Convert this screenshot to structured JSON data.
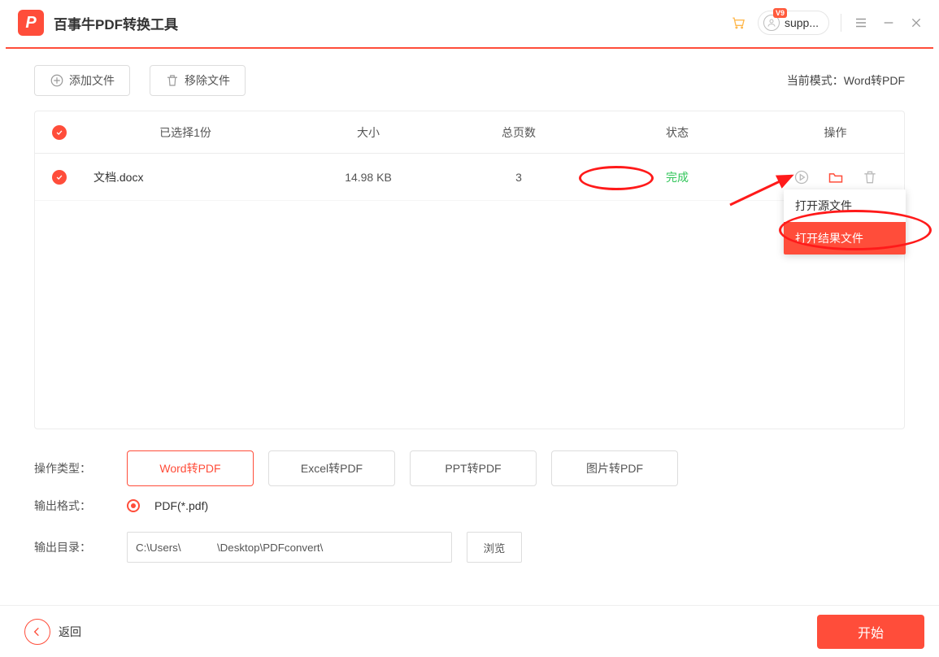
{
  "app": {
    "logo_letter": "P",
    "title": "百事牛PDF转换工具",
    "account_name": "supp...",
    "vip_text": "V9"
  },
  "toolbar": {
    "add_file_label": "添加文件",
    "remove_file_label": "移除文件",
    "mode_label": "当前模式：Word转PDF"
  },
  "table": {
    "header": {
      "selected": "已选择1份",
      "size": "大小",
      "pages": "总页数",
      "status": "状态",
      "actions": "操作"
    },
    "rows": [
      {
        "filename": "文档.docx",
        "size": "14.98 KB",
        "pages": "3",
        "status": "完成"
      }
    ]
  },
  "popover": {
    "open_source": "打开源文件",
    "open_result": "打开结果文件"
  },
  "options": {
    "type_label": "操作类型：",
    "types": [
      "Word转PDF",
      "Excel转PDF",
      "PPT转PDF",
      "图片转PDF"
    ],
    "active_index": 0,
    "format_label": "输出格式：",
    "format_value": "PDF(*.pdf)",
    "dir_label": "输出目录：",
    "dir_value": "C:\\Users\\            \\Desktop\\PDFconvert\\",
    "browse_label": "浏览"
  },
  "footer": {
    "back_label": "返回",
    "start_label": "开始"
  }
}
